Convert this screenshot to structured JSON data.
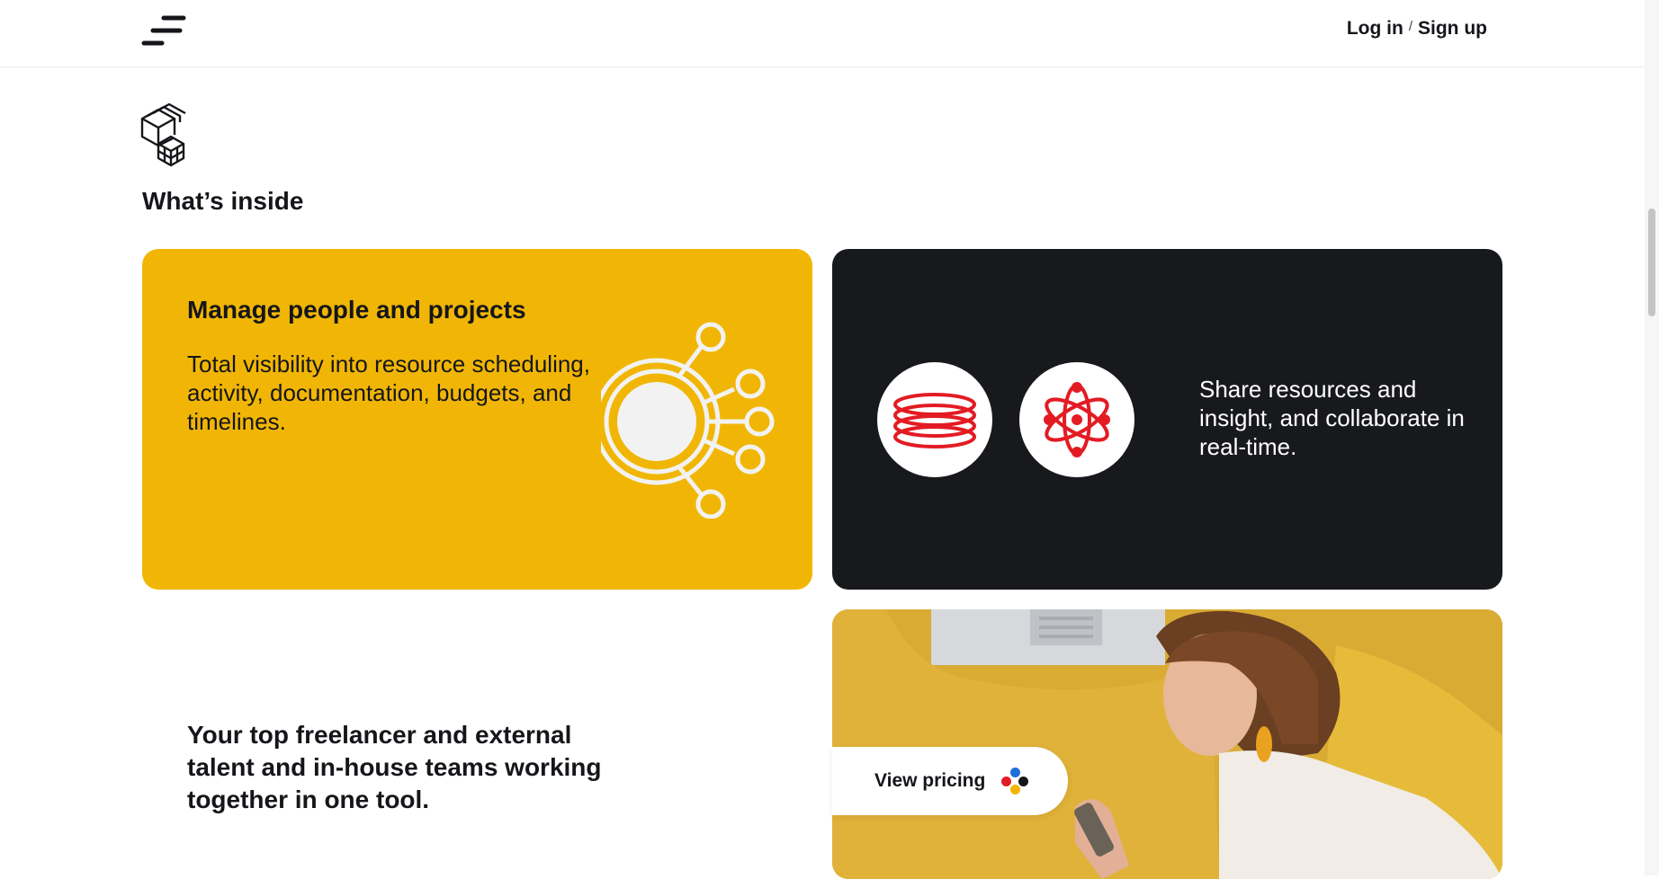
{
  "header": {
    "login_label": "Log in",
    "separator": "/",
    "signup_label": "Sign up"
  },
  "section": {
    "title": "What’s inside"
  },
  "cards": {
    "yellow": {
      "title": "Manage people and projects",
      "text": "Total visibility into resource scheduling, activity, documentation, budgets, and timelines."
    },
    "dark": {
      "text": "Share resources and insight, and collaborate in real-time."
    }
  },
  "lower": {
    "text": "Your top freelancer and external talent and in-house teams working together in one tool."
  },
  "pricing": {
    "label": "View pricing"
  },
  "colors": {
    "yellow": "#f1b605",
    "dark": "#18191d",
    "red": "#e31b23",
    "blue": "#1e6fd9",
    "black": "#15161a"
  },
  "icons": [
    "menu-icon",
    "cube-stack-icon",
    "hub-network-icon",
    "rings-icon",
    "atom-icon",
    "color-dots-icon"
  ]
}
